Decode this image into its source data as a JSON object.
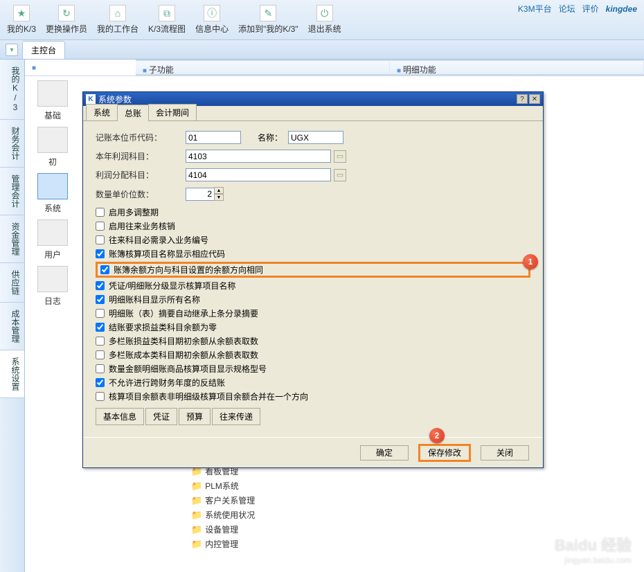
{
  "topToolbar": {
    "items": [
      {
        "label": "我的K/3"
      },
      {
        "label": "更换操作员"
      },
      {
        "label": "我的工作台"
      },
      {
        "label": "K/3流程图"
      },
      {
        "label": "信息中心"
      },
      {
        "label": "添加到\"我的K/3\""
      },
      {
        "label": "退出系统"
      }
    ],
    "right": {
      "platform": "K3M平台",
      "forum": "论坛",
      "eval": "评价",
      "brand": "kingdee"
    }
  },
  "mainTab": "主控台",
  "contentHeaders": {
    "left": "子功能",
    "right": "明细功能"
  },
  "leftNav": [
    "我的K/3",
    "财务会计",
    "管理会计",
    "资金管理",
    "供应链",
    "成本管理",
    "系统设置"
  ],
  "iconPanel": [
    "基础",
    "初",
    "系统",
    "用户",
    "日志"
  ],
  "tree": [
    "看板管理",
    "PLM系统",
    "客户关系管理",
    "系统使用状况",
    "设备管理",
    "内控管理"
  ],
  "modal": {
    "title": "系统参数",
    "tabs": [
      "系统",
      "总账",
      "会计期间"
    ],
    "fields": {
      "currency_code_label": "记账本位币代码：",
      "currency_code": "01",
      "currency_name_label": "名称：",
      "currency_name": "UGX",
      "profit_subject_label": "本年利润科目：",
      "profit_subject": "4103",
      "profit_dist_label": "利润分配科目：",
      "profit_dist": "4104",
      "qty_decimals_label": "数量单价位数：",
      "qty_decimals": "2"
    },
    "checks": [
      {
        "label": "启用多调整期",
        "checked": false
      },
      {
        "label": "启用往来业务核销",
        "checked": false
      },
      {
        "label": "往来科目必需录入业务编号",
        "checked": false
      },
      {
        "label": "账簿核算项目名称显示相应代码",
        "checked": true
      },
      {
        "label": "账簿余额方向与科目设置的余额方向相同",
        "checked": true,
        "highlight": 1
      },
      {
        "label": "凭证/明细账分级显示核算项目名称",
        "checked": true
      },
      {
        "label": "明细账科目显示所有名称",
        "checked": true
      },
      {
        "label": "明细账（表）摘要自动继承上条分录摘要",
        "checked": false
      },
      {
        "label": "结账要求损益类科目余额为零",
        "checked": true
      },
      {
        "label": "多栏账损益类科目期初余额从余额表取数",
        "checked": false
      },
      {
        "label": "多栏账成本类科目期初余额从余额表取数",
        "checked": false
      },
      {
        "label": "数量金额明细账商品核算项目显示规格型号",
        "checked": false
      },
      {
        "label": "不允许进行跨财务年度的反结账",
        "checked": true
      },
      {
        "label": "核算项目余额表非明细级核算项目余额合并在一个方向",
        "checked": false
      }
    ],
    "subTabs": [
      "基本信息",
      "凭证",
      "预算",
      "往来传递"
    ],
    "buttons": {
      "ok": "确定",
      "save": "保存修改",
      "close": "关闭"
    },
    "callouts": {
      "c1": "1",
      "c2": "2"
    }
  },
  "watermark": {
    "main": "Baidu 经验",
    "sub": "jingyan.baidu.com"
  }
}
